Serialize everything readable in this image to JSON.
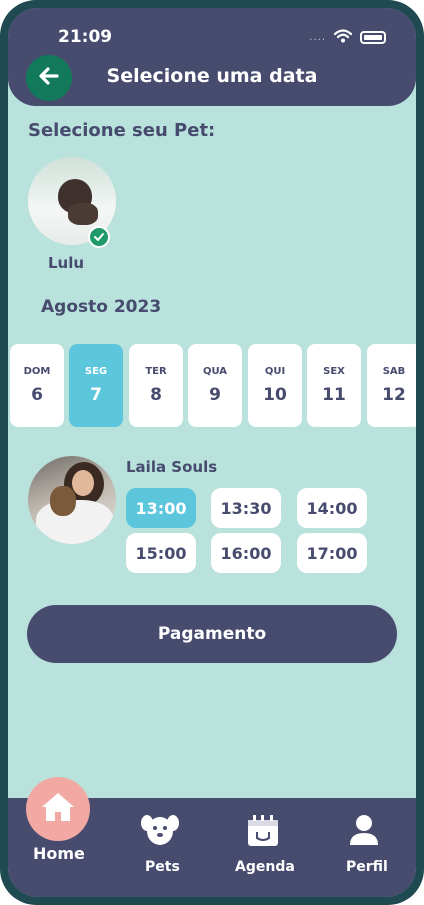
{
  "status": {
    "time": "21:09",
    "signal": "....",
    "wifi": "wifi-icon",
    "battery": "battery-icon"
  },
  "header": {
    "title": "Selecione uma data",
    "back_icon": "arrow-left-icon"
  },
  "pet_section": {
    "title": "Selecione seu Pet:",
    "pet": {
      "name": "Lulu",
      "selected": true
    }
  },
  "calendar": {
    "month": "Agosto 2023",
    "days": [
      {
        "name": "DOM",
        "num": "6"
      },
      {
        "name": "SEG",
        "num": "7",
        "selected": true
      },
      {
        "name": "TER",
        "num": "8"
      },
      {
        "name": "QUA",
        "num": "9"
      },
      {
        "name": "QUI",
        "num": "10"
      },
      {
        "name": "SEX",
        "num": "11"
      },
      {
        "name": "SAB",
        "num": "12"
      }
    ]
  },
  "professional": {
    "name": "Laila Souls",
    "slots": [
      {
        "time": "13:00",
        "selected": true
      },
      {
        "time": "13:30"
      },
      {
        "time": "14:00"
      },
      {
        "time": "15:00"
      },
      {
        "time": "16:00"
      },
      {
        "time": "17:00"
      }
    ]
  },
  "payment_button": "Pagamento",
  "bottom_nav": [
    {
      "label": "Home",
      "icon": "home-icon",
      "active": true
    },
    {
      "label": "Pets",
      "icon": "dog-face-icon"
    },
    {
      "label": "Agenda",
      "icon": "calendar-icon"
    },
    {
      "label": "Perfil",
      "icon": "user-icon"
    }
  ],
  "colors": {
    "primary": "#474b6e",
    "background": "#b9e2dd",
    "accent": "#5cc6dc",
    "home_highlight": "#f3a9a3",
    "back_button": "#127a5a"
  }
}
